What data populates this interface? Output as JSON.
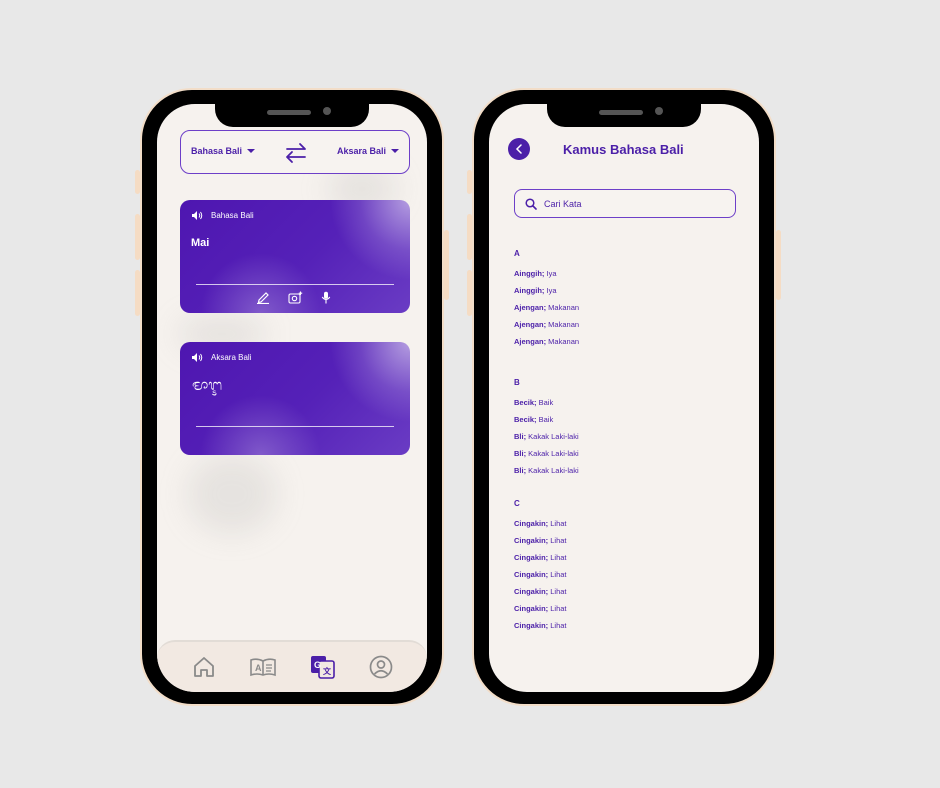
{
  "translator": {
    "source_lang": "Bahasa Bali",
    "target_lang": "Aksara Bali",
    "input_card": {
      "label": "Bahasa Bali",
      "text": "Mai"
    },
    "output_card": {
      "label": "Aksara Bali",
      "text": "ᬫᬵᬇ"
    },
    "nav": [
      "home-icon",
      "dictionary-book-icon",
      "translate-icon",
      "profile-icon"
    ],
    "active_nav": "translate-icon"
  },
  "dictionary": {
    "title": "Kamus Bahasa Bali",
    "search_placeholder": "Cari Kata",
    "sections": [
      {
        "letter": "A",
        "entries": [
          {
            "word": "Ainggih;",
            "meaning": " Iya"
          },
          {
            "word": "Ainggih;",
            "meaning": " Iya"
          },
          {
            "word": "Ajengan;",
            "meaning": " Makanan"
          },
          {
            "word": "Ajengan;",
            "meaning": " Makanan"
          },
          {
            "word": "Ajengan;",
            "meaning": " Makanan"
          }
        ]
      },
      {
        "letter": "B",
        "entries": [
          {
            "word": "Becik;",
            "meaning": " Baik"
          },
          {
            "word": "Becik;",
            "meaning": " Baik"
          },
          {
            "word": "Bli;",
            "meaning": " Kakak Laki-laki"
          },
          {
            "word": "Bli;",
            "meaning": " Kakak Laki-laki"
          },
          {
            "word": "Bli;",
            "meaning": " Kakak Laki-laki"
          }
        ]
      },
      {
        "letter": "C",
        "entries": [
          {
            "word": "Cingakin;",
            "meaning": " Lihat"
          },
          {
            "word": "Cingakin;",
            "meaning": " Lihat"
          },
          {
            "word": "Cingakin;",
            "meaning": " Lihat"
          },
          {
            "word": "Cingakin;",
            "meaning": " Lihat"
          },
          {
            "word": "Cingakin;",
            "meaning": " Lihat"
          },
          {
            "word": "Cingakin;",
            "meaning": " Lihat"
          },
          {
            "word": "Cingakin;",
            "meaning": " Lihat"
          }
        ]
      }
    ]
  },
  "colors": {
    "accent": "#4b1fa8",
    "background": "#f6f2ee",
    "page": "#e8e8e8"
  }
}
